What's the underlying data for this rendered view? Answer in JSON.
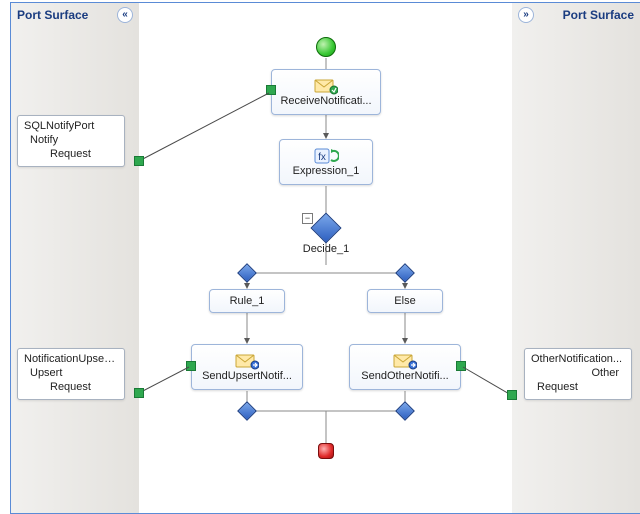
{
  "surfaces": {
    "left_title": "Port Surface",
    "right_title": "Port Surface"
  },
  "ports": {
    "sql_notify": {
      "title": "SQLNotifyPort",
      "operation": "Notify",
      "request": "Request"
    },
    "notif_upsert": {
      "title": "NotificationUpsert...",
      "operation": "Upsert",
      "request": "Request"
    },
    "other_notif": {
      "title": "OtherNotification...",
      "operation": "Other",
      "request": "Request"
    }
  },
  "shapes": {
    "receive": "ReceiveNotificati...",
    "expression": "Expression_1",
    "decision": "Decide_1",
    "rule": "Rule_1",
    "else": "Else",
    "send_upsert": "SendUpsertNotif...",
    "send_other": "SendOtherNotifi..."
  },
  "icons": {
    "collapse_left": "«",
    "expand_right": "»",
    "toggle_minus": "−"
  },
  "colors": {
    "frame": "#5a8bd6",
    "accent": "#1a3c80"
  }
}
